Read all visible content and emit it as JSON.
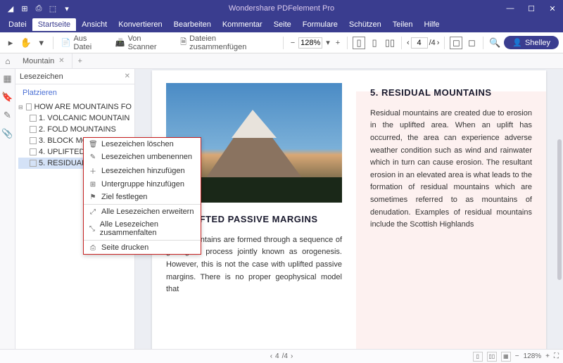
{
  "app": {
    "title": "Wondershare PDFelement Pro"
  },
  "menu": [
    "Datei",
    "Startseite",
    "Ansicht",
    "Konvertieren",
    "Bearbeiten",
    "Kommentar",
    "Seite",
    "Formulare",
    "Schützen",
    "Teilen",
    "Hilfe"
  ],
  "menu_active": 1,
  "toolbar": {
    "from_file": "Aus Datei",
    "from_scanner": "Von Scanner",
    "merge": "Dateien zusammenfügen",
    "zoom": "128%",
    "page_current": "4",
    "page_total": "/4"
  },
  "user": {
    "name": "Shelley"
  },
  "tabs": {
    "active": "Mountain"
  },
  "sidebar": {
    "title": "Lesezeichen",
    "place": "Platzieren",
    "root": "HOW ARE MOUNTAINS FO",
    "items": [
      "1. VOLCANIC MOUNTAIN",
      "2. FOLD MOUNTAINS",
      "3. BLOCK MOUNTAINS",
      "4. UPLIFTED PASSIVE",
      "5. RESIDUAL MOUNTAIN"
    ]
  },
  "ctx": {
    "delete": "Lesezeichen löschen",
    "rename": "Lesezeichen umbenennen",
    "add": "Lesezeichen hinzufügen",
    "addsub": "Untergruppe hinzufügen",
    "dest": "Ziel festlegen",
    "expand": "Alle Lesezeichen erweitern",
    "collapse": "Alle Lesezeichen zusammenfalten",
    "print": "Seite drucken"
  },
  "doc": {
    "h4": "4. UPLIFTED PASSIVE MARGINS",
    "p4": "Most mountains are formed through a sequence of geological process jointly known as orogenesis. However, this is not the case with uplifted passive margins. There is no proper geophysical model that",
    "h5": "5. RESIDUAL MOUNTAINS",
    "p5": "Residual mountains are created due to erosion in the uplifted area. When an uplift has occurred, the area can experience adverse weather condition such as wind and rainwater which in turn can cause erosion. The resultant erosion in an elevated area is what leads to the formation of residual mountains which are sometimes referred to as mountains of denudation. Examples of residual mountains include the Scottish Highlands"
  },
  "status": {
    "page": "4",
    "total": "/4",
    "zoom": "128%"
  }
}
